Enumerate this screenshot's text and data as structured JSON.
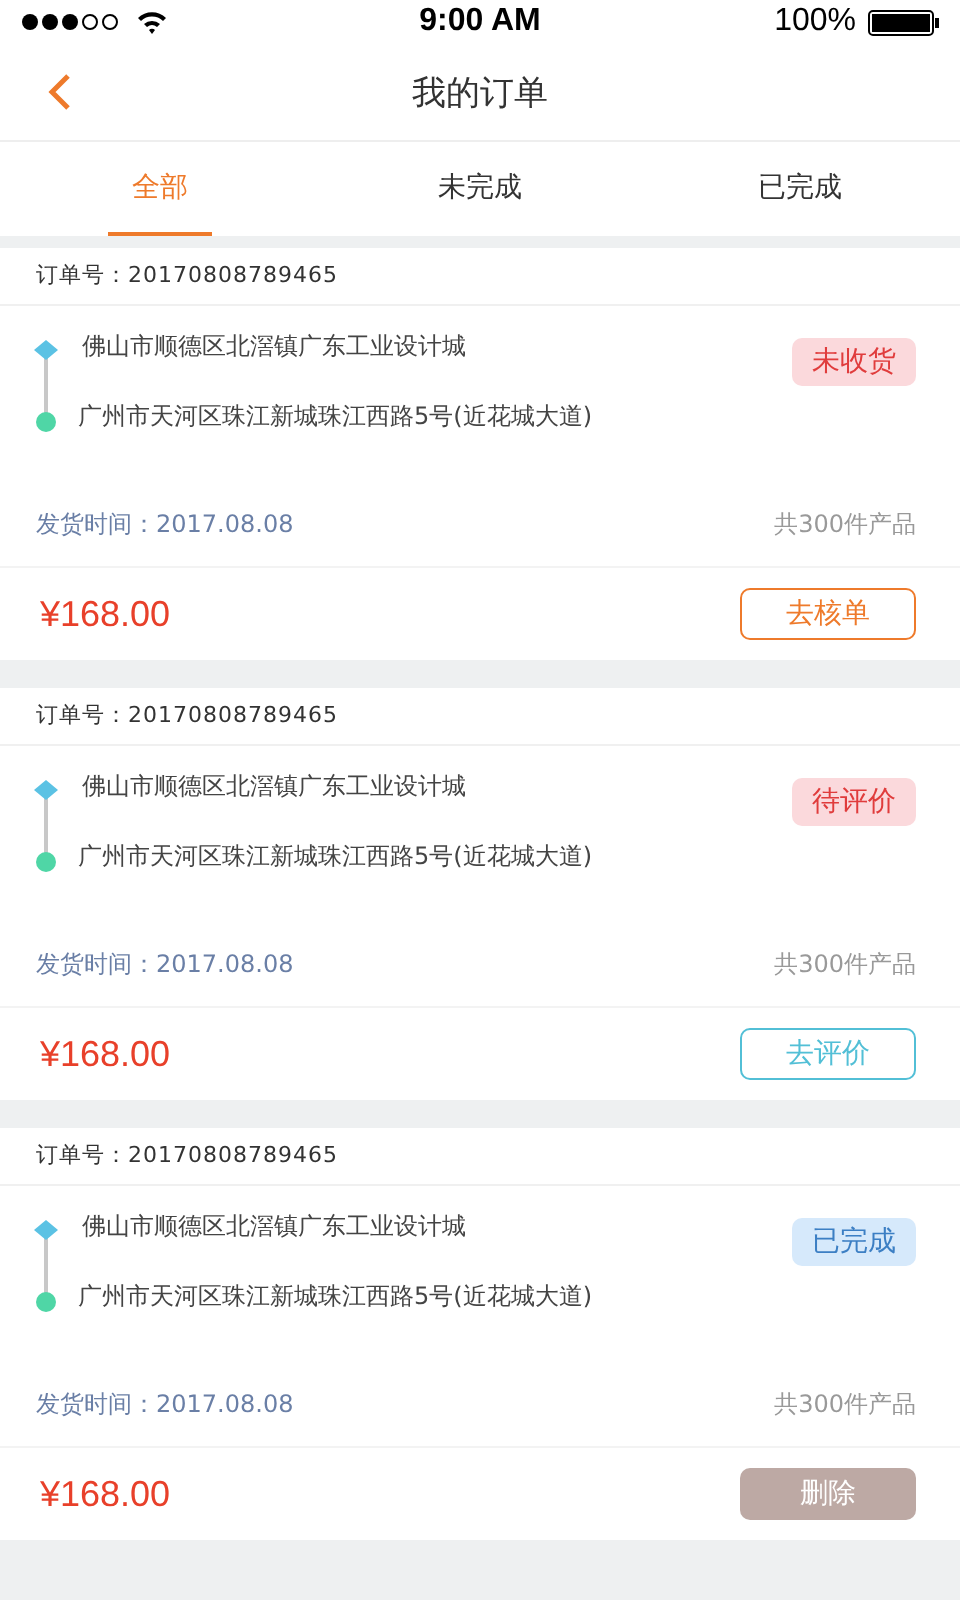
{
  "status_bar": {
    "time": "9:00 AM",
    "battery": "100%"
  },
  "nav": {
    "title": "我的订单"
  },
  "tabs": [
    {
      "label": "全部",
      "selected": true
    },
    {
      "label": "未完成",
      "selected": false
    },
    {
      "label": "已完成",
      "selected": false
    }
  ],
  "orders": [
    {
      "order_label": "订单号：20170808789465",
      "from": "佛山市顺德区北滘镇广东工业设计城",
      "to": "广州市天河区珠江新城珠江西路5号(近花城大道)",
      "status": {
        "text": "未收货",
        "kind": "pending"
      },
      "ship_time": "发货时间：2017.08.08",
      "count": "共300件产品",
      "price": "¥168.00",
      "action": {
        "label": "去核单",
        "kind": "verify"
      }
    },
    {
      "order_label": "订单号：20170808789465",
      "from": "佛山市顺德区北滘镇广东工业设计城",
      "to": "广州市天河区珠江新城珠江西路5号(近花城大道)",
      "status": {
        "text": "待评价",
        "kind": "review"
      },
      "ship_time": "发货时间：2017.08.08",
      "count": "共300件产品",
      "price": "¥168.00",
      "action": {
        "label": "去评价",
        "kind": "rate"
      }
    },
    {
      "order_label": "订单号：20170808789465",
      "from": "佛山市顺德区北滘镇广东工业设计城",
      "to": "广州市天河区珠江新城珠江西路5号(近花城大道)",
      "status": {
        "text": "已完成",
        "kind": "done"
      },
      "ship_time": "发货时间：2017.08.08",
      "count": "共300件产品",
      "price": "¥168.00",
      "action": {
        "label": "删除",
        "kind": "delete"
      }
    }
  ]
}
